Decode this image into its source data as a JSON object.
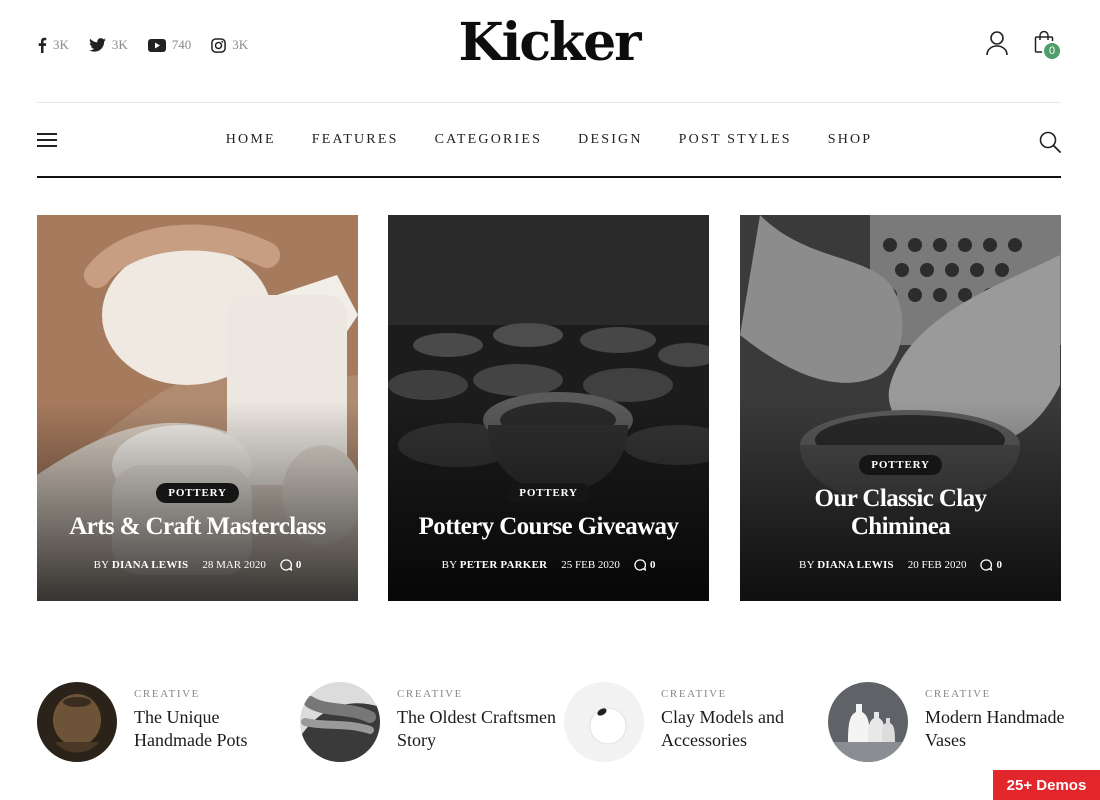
{
  "socials": [
    {
      "icon": "facebook-icon",
      "count": "3K"
    },
    {
      "icon": "twitter-icon",
      "count": "3K"
    },
    {
      "icon": "youtube-icon",
      "count": "740"
    },
    {
      "icon": "instagram-icon",
      "count": "3K"
    }
  ],
  "brand": {
    "logo": "Kicker"
  },
  "cart": {
    "count": "0"
  },
  "nav": {
    "items": [
      "HOME",
      "FEATURES",
      "CATEGORIES",
      "DESIGN",
      "POST STYLES",
      "SHOP"
    ]
  },
  "featured": [
    {
      "category": "POTTERY",
      "title": "Arts & Craft Masterclass",
      "by": "BY",
      "author": "DIANA LEWIS",
      "date": "28 MAR 2020",
      "comments": "0"
    },
    {
      "category": "POTTERY",
      "title": "Pottery Course Giveaway",
      "by": "BY",
      "author": "PETER PARKER",
      "date": "25 FEB 2020",
      "comments": "0"
    },
    {
      "category": "POTTERY",
      "title": "Our Classic Clay Chiminea",
      "by": "BY",
      "author": "DIANA LEWIS",
      "date": "20 FEB 2020",
      "comments": "0"
    }
  ],
  "minis": [
    {
      "category": "CREATIVE",
      "title": "The Unique Handmade Pots"
    },
    {
      "category": "CREATIVE",
      "title": "The Oldest Craftsmen Story"
    },
    {
      "category": "CREATIVE",
      "title": "Clay Models and Accessories"
    },
    {
      "category": "CREATIVE",
      "title": "Modern Handmade Vases"
    }
  ],
  "demos_badge": "25+ Demos",
  "colors": {
    "accent": "#4f9d6a",
    "badge_red": "#e3262c",
    "text": "#111111"
  }
}
